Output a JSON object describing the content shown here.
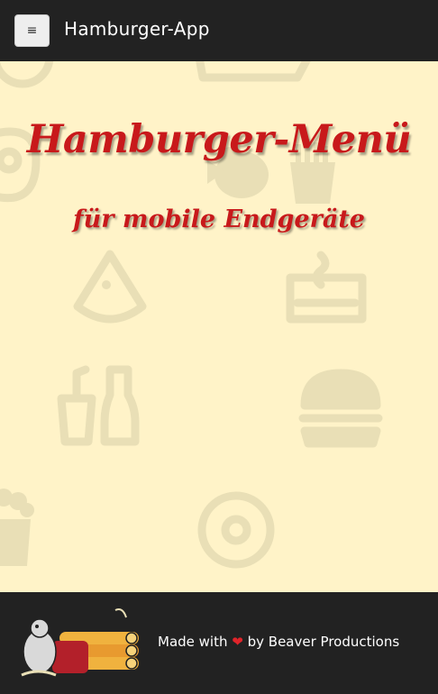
{
  "navbar": {
    "menu_icon": "bars-icon",
    "menu_glyph": "≡",
    "brand": "Hamburger-App"
  },
  "hero": {
    "headline": "Hamburger-Menü",
    "subline": "für mobile Endgeräte",
    "background_icons": [
      "pizza-slice-icon",
      "pretzel-icon",
      "fish-icon",
      "fries-icon",
      "hot-dish-icon",
      "drinks-icon",
      "burger-icon",
      "popcorn-icon",
      "donut-icon"
    ]
  },
  "footer": {
    "made_with": "Made with",
    "heart": "❤",
    "by": "by Beaver Productions",
    "logo_icon": "beaver-logo-icon"
  },
  "colors": {
    "bar_bg": "#222222",
    "hero_bg": "#fff3c8",
    "headline": "#c8191b",
    "icon_tint": "#e9dfb6",
    "heart": "#e0242a"
  }
}
